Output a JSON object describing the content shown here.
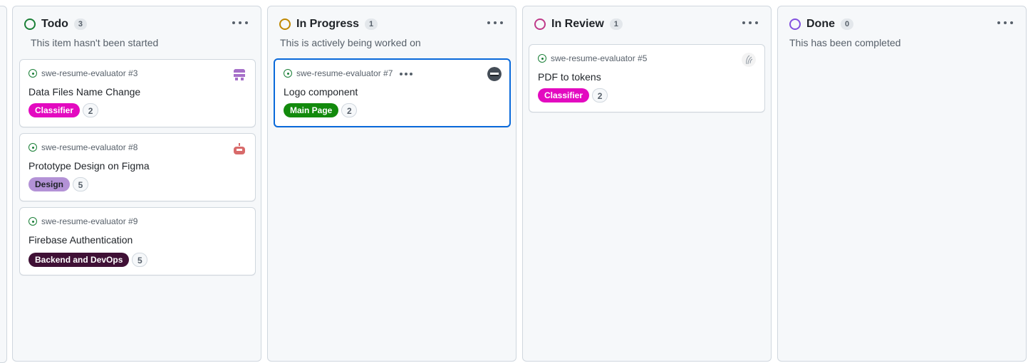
{
  "columns": [
    {
      "title": "Todo",
      "count": "3",
      "description": "This item hasn't been started",
      "status_color": "#1a7f37",
      "cards": [
        {
          "ref": "swe-resume-evaluator #3",
          "title": "Data Files Name Change",
          "label": "Classifier",
          "label_color": "#e30ac0",
          "estimate": "2",
          "avatar": "identicon-purple"
        },
        {
          "ref": "swe-resume-evaluator #8",
          "title": "Prototype Design on Figma",
          "label": "Design",
          "label_color": "#b392d6",
          "estimate": "5",
          "avatar": "identicon-red"
        },
        {
          "ref": "swe-resume-evaluator #9",
          "title": "Firebase Authentication",
          "label": "Backend and DevOps",
          "label_color": "#3f1035",
          "estimate": "5"
        }
      ]
    },
    {
      "title": "In Progress",
      "count": "1",
      "description": "This is actively being worked on",
      "status_color": "#bf8700",
      "cards": [
        {
          "ref": "swe-resume-evaluator #7",
          "title": "Logo component",
          "label": "Main Page",
          "label_color": "#128a0c",
          "estimate": "2",
          "avatar": "avatar-dark"
        }
      ]
    },
    {
      "title": "In Review",
      "count": "1",
      "description": "",
      "status_color": "#bf3989",
      "cards": [
        {
          "ref": "swe-resume-evaluator #5",
          "title": "PDF to tokens",
          "label": "Classifier",
          "label_color": "#e30ac0",
          "estimate": "2",
          "avatar": "avatar-sketch"
        }
      ]
    },
    {
      "title": "Done",
      "count": "0",
      "description": "This has been completed",
      "status_color": "#8250df",
      "cards": []
    }
  ],
  "colors": {
    "column_bg": "#f6f8fa",
    "border": "#d0d7de",
    "selected_border": "#0969da",
    "issue_open": "#1a7f37"
  }
}
